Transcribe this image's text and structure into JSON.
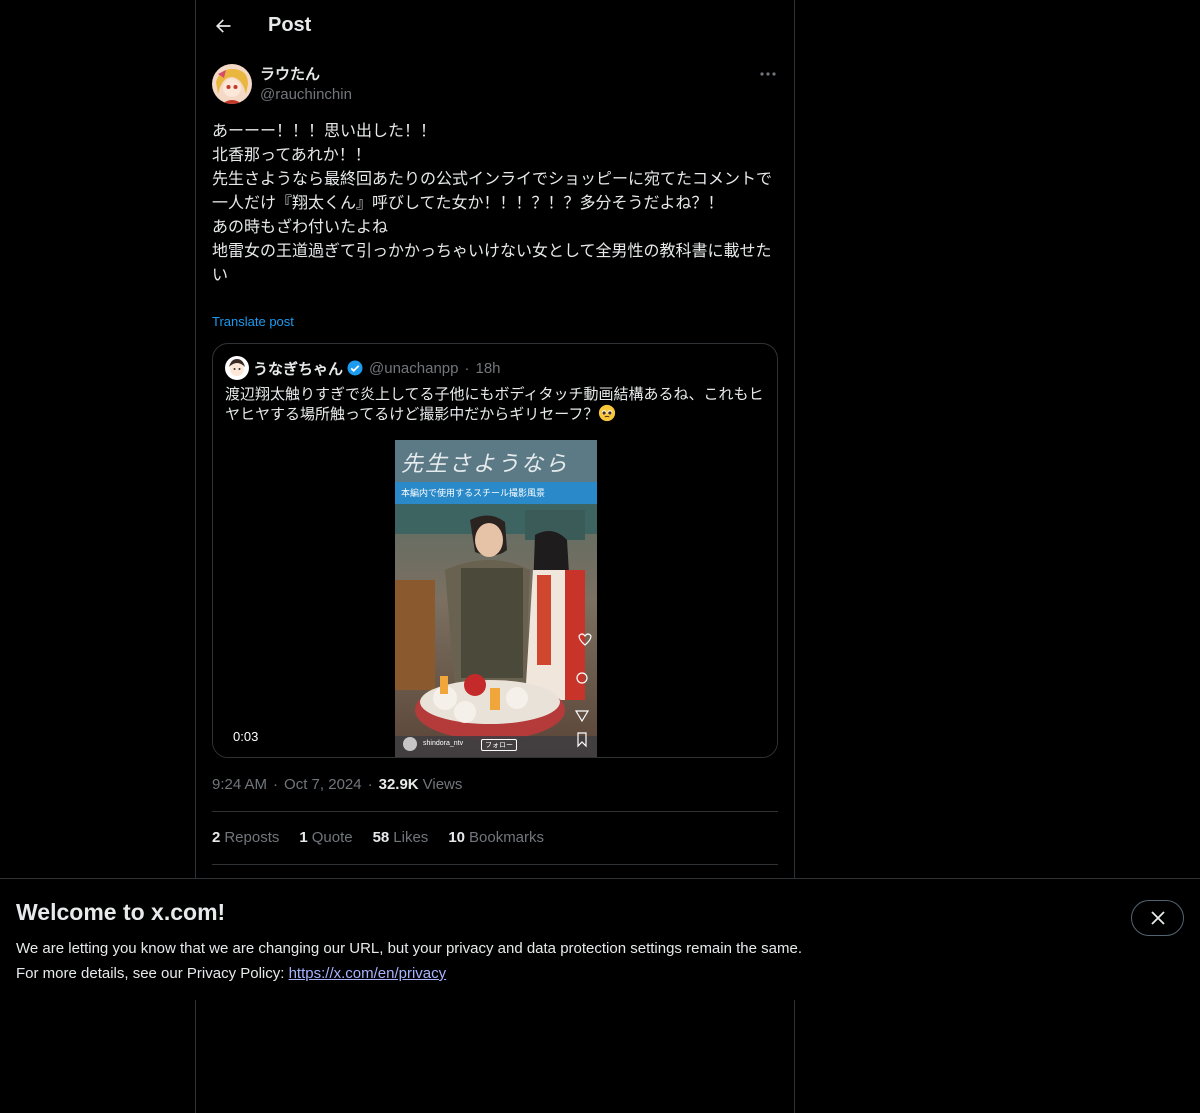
{
  "header": {
    "title": "Post"
  },
  "post": {
    "author": {
      "name": "ラウたん",
      "handle": "@rauchinchin"
    },
    "lines": [
      "あーーー！！！思い出した！！",
      "北香那ってあれか！！",
      "先生さようなら最終回あたりの公式インライでショッピーに宛てたコメントで一人だけ『翔太くん』呼びしてた女か！！！？！？多分そうだよね？！",
      "あの時もざわ付いたよね",
      "地雷女の王道過ぎて引っかかっちゃいけない女として全男性の教科書に載せたい"
    ],
    "translate_label": "Translate post",
    "time": "9:24 AM",
    "date": "Oct 7, 2024",
    "views_count": "32.9K",
    "views_label": "Views"
  },
  "quote": {
    "name": "うなぎちゃん",
    "handle": "@unachanpp",
    "age": "18h",
    "text": "渡辺翔太触りすぎで炎上してる子他にもボディタッチ動画結構あるね、これもヒヤヒヤする場所触ってるけど撮影中だからギリセーフ？",
    "video_duration": "0:03",
    "video_caption_title": "先生さようなら",
    "video_caption_sub": "本編内で使用するスチール撮影風景",
    "video_account": "shindora_ntv",
    "video_follow": "フォロー"
  },
  "stats": {
    "reposts_count": "2",
    "reposts_label": "Reposts",
    "quotes_count": "1",
    "quotes_label": "Quote",
    "likes_count": "58",
    "likes_label": "Likes",
    "bookmarks_count": "10",
    "bookmarks_label": "Bookmarks"
  },
  "banner": {
    "title": "Welcome to x.com!",
    "line1": "We are letting you know that we are changing our URL, but your privacy and data protection settings remain the same.",
    "line2_prefix": "For more details, see our Privacy Policy: ",
    "link": "https://x.com/en/privacy"
  },
  "colors": {
    "accent": "#1d9bf0",
    "background": "#000000",
    "muted": "#71767b",
    "border": "#2f3336"
  },
  "icons": {
    "back": "arrow-left-icon",
    "more": "more-horizontal-icon",
    "verified": "verified-badge-icon",
    "close": "close-icon"
  }
}
